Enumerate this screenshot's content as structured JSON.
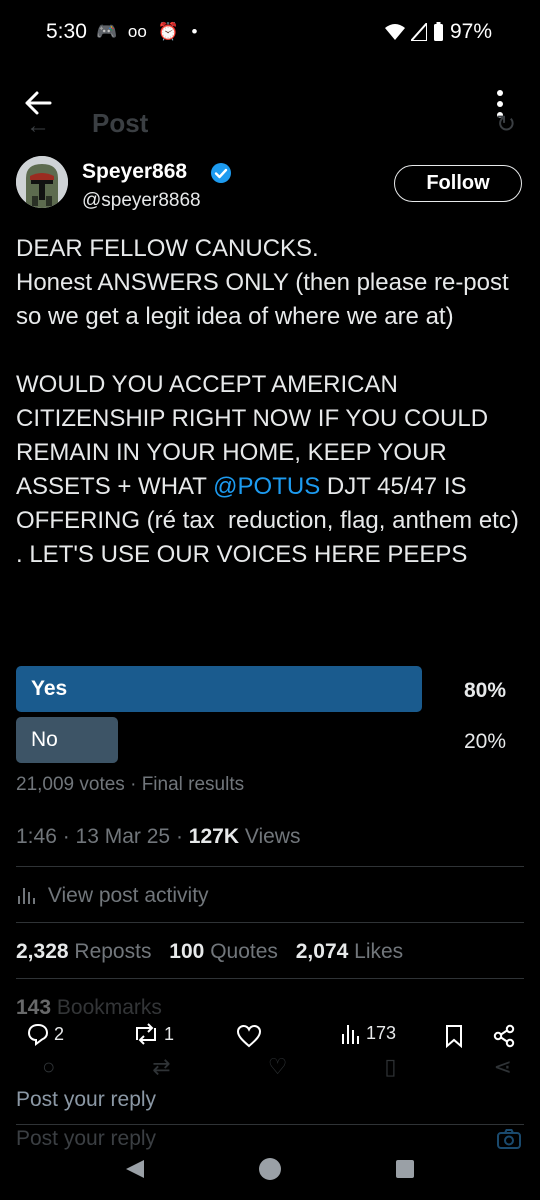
{
  "status_bar": {
    "time": "5:30",
    "battery": "97%"
  },
  "header": {
    "ghost_title": "Post"
  },
  "author": {
    "display_name": "Speyer868",
    "handle": "@speyer8868",
    "ghost_name": "Speyer868",
    "ghost_handle": "@speyer8868",
    "verified_color": "#1d9bf0"
  },
  "follow_label": "Follow",
  "post": {
    "line1": "DEAR FELLOW CANUCKS.",
    "line2": "Honest ANSWERS ONLY (then please re-post so we get a legit idea of where we are at)",
    "para2_before": "WOULD YOU ACCEPT AMERICAN CITIZENSHIP RIGHT NOW IF YOU COULD REMAIN IN YOUR HOME, KEEP YOUR ASSETS + WHAT ",
    "mention": "@POTUS",
    "para2_after": " DJT 45/47 IS OFFERING (ré tax  reduction, flag, anthem etc) . LET'S USE OUR VOICES HERE PEEPS"
  },
  "poll": {
    "options": [
      {
        "label": "Yes",
        "percent": "80%",
        "fraction": 0.8,
        "color": "#1a5b8e"
      },
      {
        "label": "No",
        "percent": "20%",
        "fraction": 0.2,
        "color": "#3d5466"
      }
    ],
    "votes": "21,009 votes",
    "separator": "·",
    "status": "Final results"
  },
  "timestamp": {
    "time": "1:46",
    "date": "13 Mar 25",
    "views_count": "127K",
    "views_label": "Views"
  },
  "activity_label": "View post activity",
  "stats": {
    "reposts_count": "2,328",
    "reposts_label": "Reposts",
    "quotes_count": "100",
    "quotes_label": "Quotes",
    "likes_count": "2,074",
    "likes_label": "Likes",
    "bookmarks_count": "143",
    "bookmarks_label": "Bookmarks"
  },
  "actions": {
    "replies": "2",
    "reposts": "1",
    "views": "173"
  },
  "reply": {
    "placeholder": "Post your reply",
    "ghost_placeholder": "Post your reply"
  }
}
